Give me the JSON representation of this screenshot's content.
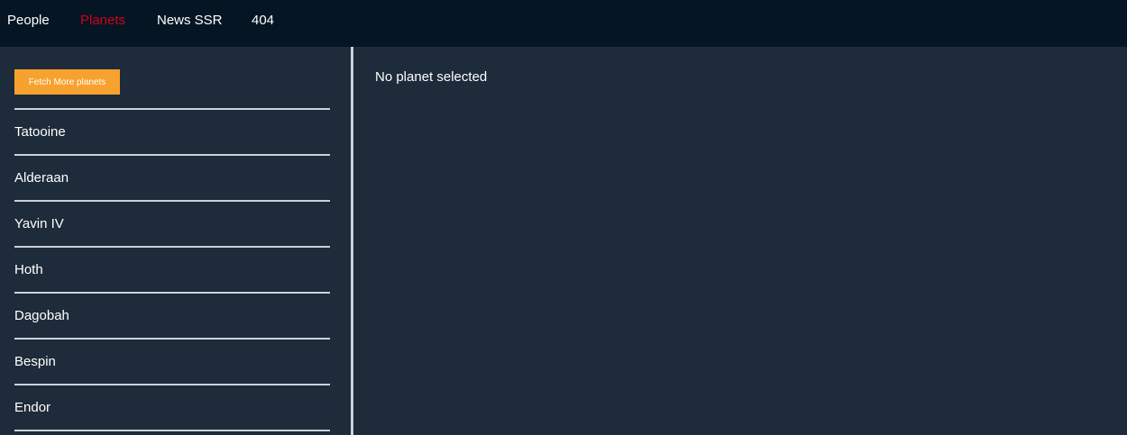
{
  "nav": {
    "items": [
      {
        "label": "People"
      },
      {
        "label": "Planets"
      },
      {
        "label": "News SSR"
      },
      {
        "label": "404"
      }
    ]
  },
  "sidebar": {
    "fetch_label": "Fetch More planets",
    "planets": [
      {
        "name": "Tatooine"
      },
      {
        "name": "Alderaan"
      },
      {
        "name": "Yavin IV"
      },
      {
        "name": "Hoth"
      },
      {
        "name": "Dagobah"
      },
      {
        "name": "Bespin"
      },
      {
        "name": "Endor"
      }
    ]
  },
  "main": {
    "empty_message": "No planet selected"
  },
  "colors": {
    "nav_bg": "#051523",
    "page_bg": "#1d2b3a",
    "active_link": "#d0021b",
    "button_bg": "#f7a22e",
    "rule": "#c9d3d9"
  }
}
